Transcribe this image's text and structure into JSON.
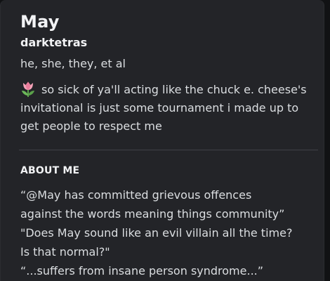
{
  "profile": {
    "display_name": "May",
    "username": "darktetras",
    "pronouns": "he, she, they, et al",
    "status": {
      "emoji": "tulip-icon",
      "text": "so sick of ya'll acting like the chuck e. cheese's invitational is just some tournament i made up to get people to respect me"
    },
    "about": {
      "title": "ABOUT ME",
      "lines": [
        "“@May has committed grievous offences",
        "against the words meaning things community”",
        "\"Does May sound like an evil villain all the time?",
        "Is that normal?\"",
        "“...suffers from insane person syndrome...”"
      ]
    }
  },
  "colors": {
    "card_bg": "#232428",
    "outer_bg": "#111214",
    "text_primary": "#f2f3f5",
    "text_secondary": "#dbdee1",
    "divider": "#3f4147"
  }
}
